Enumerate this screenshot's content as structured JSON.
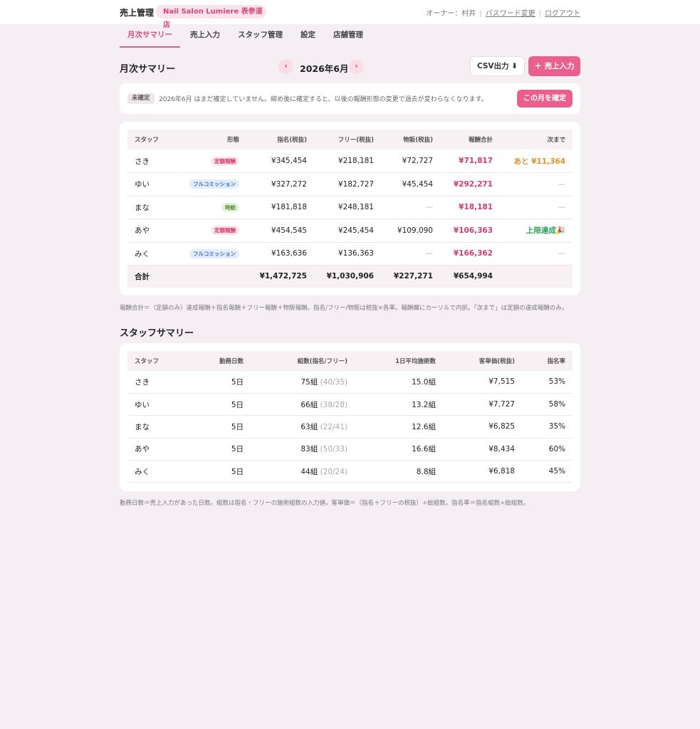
{
  "header": {
    "brand": "売上管理",
    "store": "Nail Salon Lumiere 表参道店",
    "owner": "オーナー：村井",
    "change_password": "パスワード変更",
    "logout": "ログアウト"
  },
  "tabs": [
    {
      "label": "月次サマリー",
      "active": true
    },
    {
      "label": "売上入力",
      "active": false
    },
    {
      "label": "スタッフ管理",
      "active": false
    },
    {
      "label": "設定",
      "active": false
    },
    {
      "label": "店舗管理",
      "active": false
    }
  ],
  "month_header": {
    "title": "月次サマリー",
    "prev": "‹",
    "month": "2026年6月",
    "next": "›",
    "csv_button": "CSV出力 ⬇",
    "add_button": "＋ 売上入力"
  },
  "notice": {
    "badge": "未確定",
    "text": "2026年6月 はまだ確定していません。締め後に確定すると、以後の報酬形態の変更で過去が変わらなくなります。",
    "confirm_button": "この月を確定"
  },
  "monthly_table": {
    "headers": [
      "スタッフ",
      "形態",
      "指名(税抜)",
      "フリー(税抜)",
      "物販(税抜)",
      "報酬合計",
      "次まで"
    ],
    "rows": [
      {
        "staff": "さき",
        "type": "定額報酬",
        "type_kind": "fixed",
        "nominated": "¥345,454",
        "free": "¥218,181",
        "retail": "¥72,727",
        "pay": "¥71,817",
        "next": "あと ¥11,364",
        "next_kind": "orange"
      },
      {
        "staff": "ゆい",
        "type": "フルコミッション",
        "type_kind": "full",
        "nominated": "¥327,272",
        "free": "¥182,727",
        "retail": "¥45,454",
        "pay": "¥292,271",
        "next": "—",
        "next_kind": "dash"
      },
      {
        "staff": "まな",
        "type": "時給",
        "type_kind": "hourly",
        "nominated": "¥181,818",
        "free": "¥248,181",
        "retail": "—",
        "pay": "¥18,181",
        "next": "—",
        "next_kind": "dash"
      },
      {
        "staff": "あや",
        "type": "定額報酬",
        "type_kind": "fixed",
        "nominated": "¥454,545",
        "free": "¥245,454",
        "retail": "¥109,090",
        "pay": "¥106,363",
        "next": "上限達成🎉",
        "next_kind": "green"
      },
      {
        "staff": "みく",
        "type": "フルコミッション",
        "type_kind": "full",
        "nominated": "¥163,636",
        "free": "¥136,363",
        "retail": "—",
        "pay": "¥166,362",
        "next": "—",
        "next_kind": "dash"
      }
    ],
    "total": {
      "label": "合計",
      "nominated": "¥1,472,725",
      "free": "¥1,030,906",
      "retail": "¥227,271",
      "pay": "¥654,994"
    }
  },
  "note_1": "報酬合計＝（定額のみ）達成報酬＋指名報酬＋フリー報酬＋物販報酬。指名/フリー/物販は税抜×各率。報酬欄にカーソルで内訳。「次まで」は定額の達成報酬のみ。",
  "staff_summary": {
    "title": "スタッフサマリー",
    "headers": [
      "スタッフ",
      "勤務日数",
      "組数(指名/フリー)",
      "1日平均施術数",
      "客単価(税抜)",
      "指名率"
    ],
    "rows": [
      {
        "staff": "さき",
        "days": "5日",
        "groups": "75組",
        "groups_detail": "(40/35)",
        "avg": "15.0組",
        "unit_price": "¥7,515",
        "rate": "53%"
      },
      {
        "staff": "ゆい",
        "days": "5日",
        "groups": "66組",
        "groups_detail": "(38/28)",
        "avg": "13.2組",
        "unit_price": "¥7,727",
        "rate": "58%"
      },
      {
        "staff": "まな",
        "days": "5日",
        "groups": "63組",
        "groups_detail": "(22/41)",
        "avg": "12.6組",
        "unit_price": "¥6,825",
        "rate": "35%"
      },
      {
        "staff": "あや",
        "days": "5日",
        "groups": "83組",
        "groups_detail": "(50/33)",
        "avg": "16.6組",
        "unit_price": "¥8,434",
        "rate": "60%"
      },
      {
        "staff": "みく",
        "days": "5日",
        "groups": "44組",
        "groups_detail": "(20/24)",
        "avg": "8.8組",
        "unit_price": "¥6,818",
        "rate": "45%"
      }
    ]
  },
  "note_2": "勤務日数＝売上入力があった日数。組数は指名・フリーの施術組数の入力値。客単価＝（指名＋フリーの税抜）÷総組数。指名率＝指名組数÷総組数。"
}
